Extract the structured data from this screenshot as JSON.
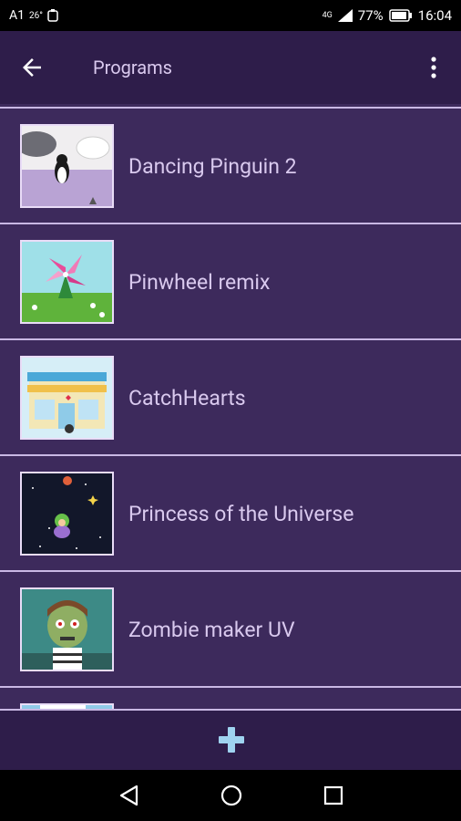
{
  "status_bar": {
    "carrier": "A1",
    "temperature": "26°",
    "battery": "77%",
    "time": "16:04",
    "network": "4G"
  },
  "app_bar": {
    "title": "Programs"
  },
  "programs": [
    {
      "name": "Dancing Pinguin 2"
    },
    {
      "name": "Pinwheel remix"
    },
    {
      "name": "CatchHearts"
    },
    {
      "name": "Princess of the Universe"
    },
    {
      "name": "Zombie maker UV"
    },
    {
      "name": ""
    }
  ],
  "colors": {
    "background": "#3d2a5c",
    "app_bar": "#2e1d4a",
    "divider": "#c9b8e4",
    "text": "#d9c9ee",
    "accent": "#9fd3f0"
  },
  "icons": {
    "back": "arrow-left-icon",
    "menu": "more-vert-icon",
    "add": "plus-icon",
    "nav_back": "triangle-back-icon",
    "nav_home": "circle-home-icon",
    "nav_recent": "square-recent-icon"
  }
}
